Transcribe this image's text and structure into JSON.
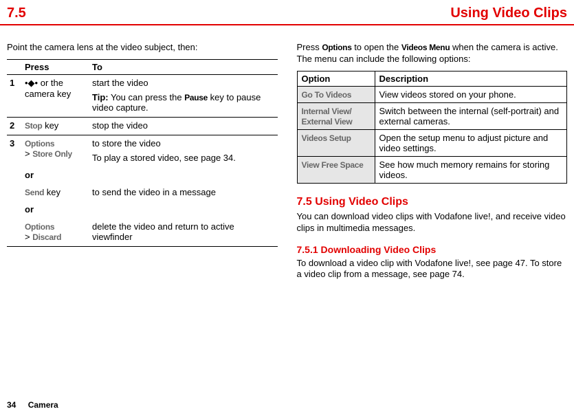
{
  "header": {
    "section_number": "7.5",
    "section_title": "Using Video Clips"
  },
  "left": {
    "intro": "Point the camera lens at the video subject, then:",
    "table": {
      "head_press": "Press",
      "head_to": "To",
      "rows": {
        "r1": {
          "num": "1",
          "press_prefix": "",
          "press_suffix": " or the camera key",
          "to_main": "start the video",
          "tip_label": "Tip:",
          "tip_text": " You can press the ",
          "tip_key": "Pause",
          "tip_text2": " key to pause video capture."
        },
        "r2": {
          "num": "2",
          "key": "Stop",
          "key_suffix": " key",
          "to": "stop the video"
        },
        "r3a": {
          "num": "3",
          "opt1": "Options",
          "opt1b": "Store Only",
          "to1": "to store the video",
          "to1b": "To play a stored video, see page 34.",
          "or": "or",
          "send": "Send",
          "send_suffix": " key",
          "to_send": "to send the video in a message",
          "opt2": "Options",
          "opt2b": "Discard",
          "to_discard": "delete the video and return to active viewfinder"
        }
      }
    }
  },
  "right": {
    "intro_pre": "Press ",
    "intro_k1": "Options",
    "intro_mid": " to open the ",
    "intro_k2": "Videos Menu",
    "intro_post": " when the camera is active. The menu can include the following options:",
    "table": {
      "head_option": "Option",
      "head_desc": "Description",
      "rows": [
        {
          "opt": "Go To Videos",
          "desc": "View videos stored on your phone."
        },
        {
          "opt": "Internal View/\nExternal View",
          "desc": "Switch between the internal (self-portrait) and external cameras."
        },
        {
          "opt": "Videos Setup",
          "desc": "Open the setup menu to adjust picture and video settings."
        },
        {
          "opt": "View Free Space",
          "desc": "See how much memory remains for storing videos."
        }
      ]
    },
    "h2": "7.5 Using Video Clips",
    "p1": "You can download video clips with Vodafone live!, and receive video clips in multimedia messages.",
    "h3": "7.5.1 Downloading Video Clips",
    "p2": "To download a video clip with Vodafone live!, see page 47. To store a video clip from a message, see page 74."
  },
  "footer": {
    "page": "34",
    "chapter": "Camera"
  }
}
